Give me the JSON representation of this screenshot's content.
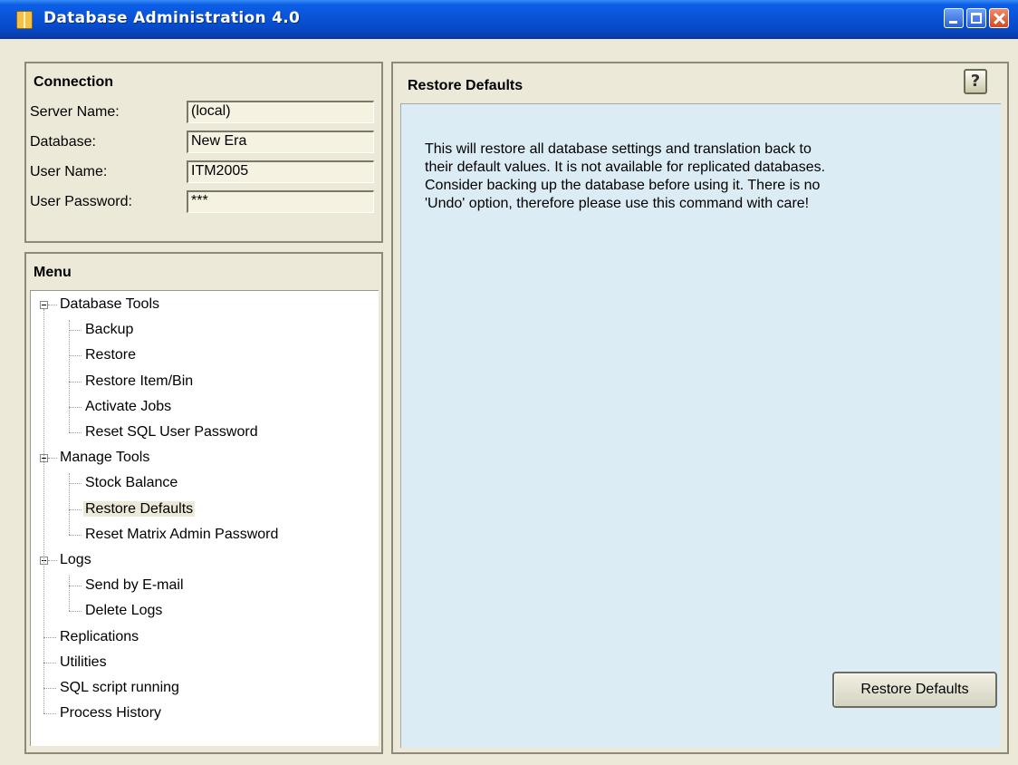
{
  "window": {
    "title": "Database Administration 4.0"
  },
  "connection": {
    "header": "Connection",
    "fields": [
      {
        "label": "Server Name:",
        "value": "(local)"
      },
      {
        "label": "Database:",
        "value": "New Era"
      },
      {
        "label": "User Name:",
        "value": "ITM2005"
      },
      {
        "label": "User Password:",
        "value": "***"
      }
    ]
  },
  "menu": {
    "header": "Menu",
    "tree": [
      {
        "label": "Database Tools",
        "level": 0,
        "expanded": true
      },
      {
        "label": "Backup",
        "level": 1
      },
      {
        "label": "Restore",
        "level": 1
      },
      {
        "label": "Restore Item/Bin",
        "level": 1
      },
      {
        "label": "Activate Jobs",
        "level": 1
      },
      {
        "label": "Reset SQL User Password",
        "level": 1
      },
      {
        "label": "Manage Tools",
        "level": 0,
        "expanded": true
      },
      {
        "label": "Stock Balance",
        "level": 1
      },
      {
        "label": "Restore Defaults",
        "level": 1,
        "selected": true
      },
      {
        "label": "Reset Matrix Admin Password",
        "level": 1
      },
      {
        "label": "Logs",
        "level": 0,
        "expanded": true
      },
      {
        "label": "Send by E-mail",
        "level": 1
      },
      {
        "label": "Delete Logs",
        "level": 1
      },
      {
        "label": "Replications",
        "level": 0
      },
      {
        "label": "Utilities",
        "level": 0
      },
      {
        "label": "SQL script running",
        "level": 0
      },
      {
        "label": "Process  History",
        "level": 0
      }
    ]
  },
  "content": {
    "title": "Restore Defaults",
    "help_label": "?",
    "description_lines": [
      "This will restore all database settings and translation back to",
      "their default values. It is not available for replicated databases.",
      "Consider backing up the database before using it. There is no",
      "'Undo' option, therefore please use this command with care!"
    ],
    "action_button_label": "Restore Defaults"
  },
  "colors": {
    "titlebar": "#0a53d8",
    "content_bg": "#dcecf4",
    "panel_bg": "#ece9d8"
  }
}
